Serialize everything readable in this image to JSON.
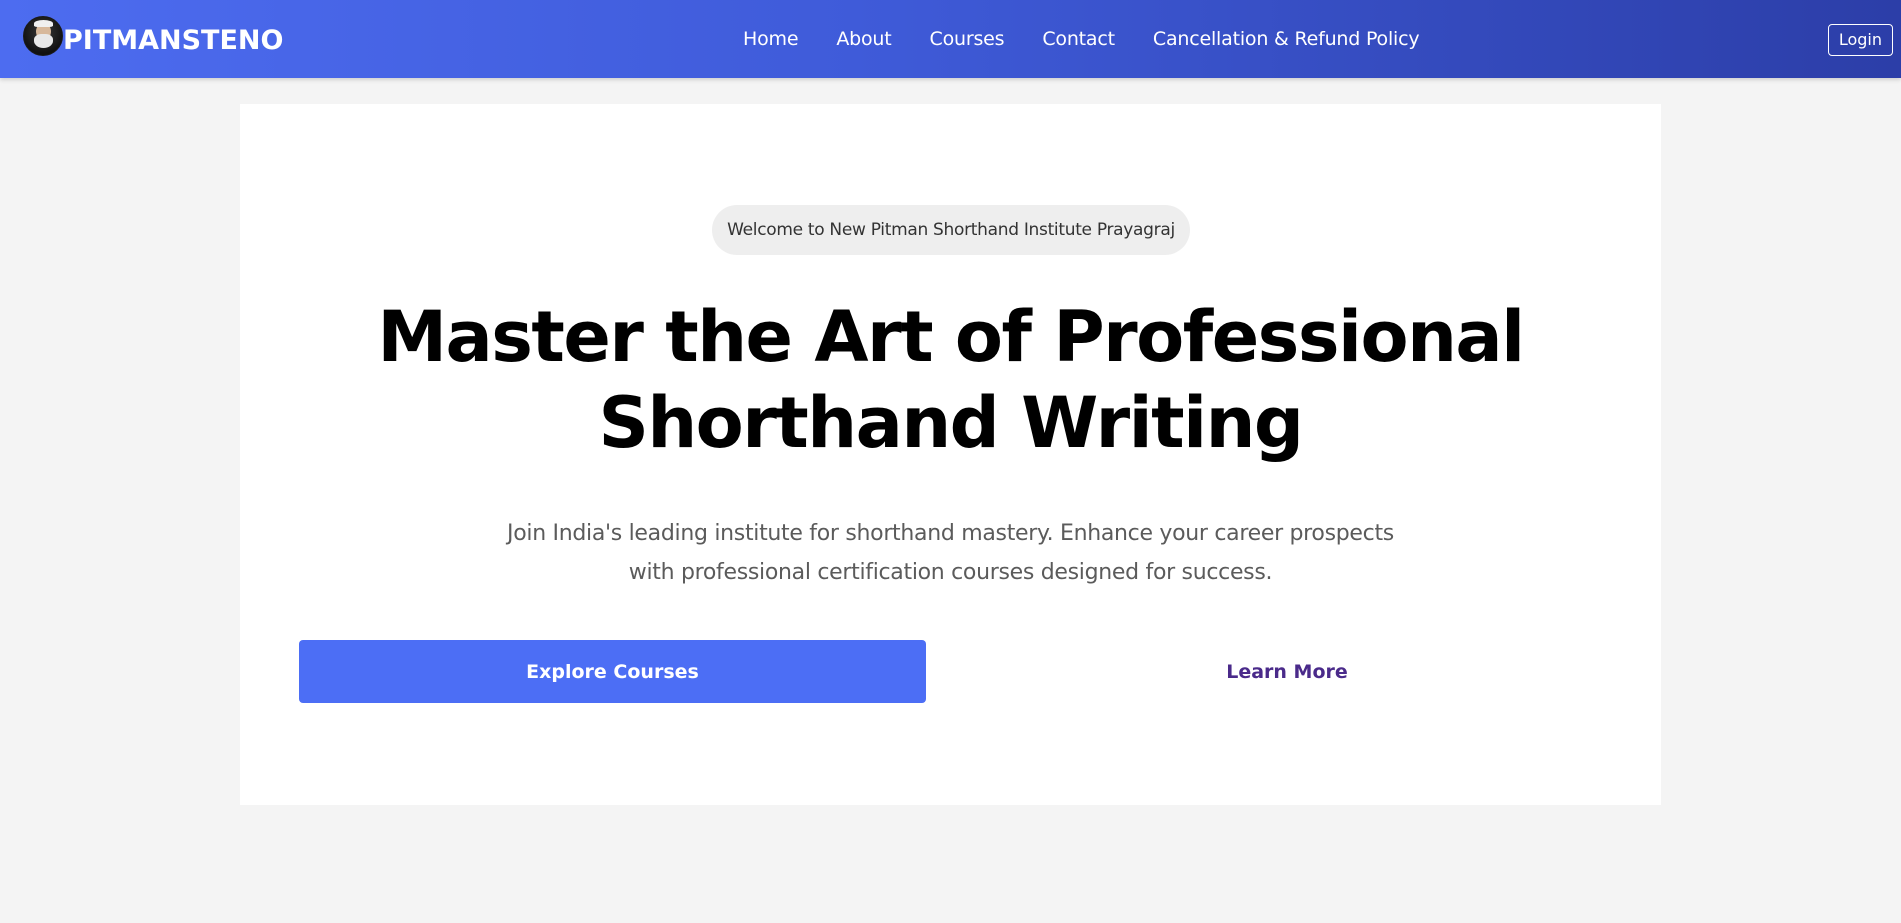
{
  "brand": {
    "name": "PITMANSTENO",
    "logo_icon": "avatar-logo-icon"
  },
  "nav": {
    "items": [
      {
        "label": "Home"
      },
      {
        "label": "About"
      },
      {
        "label": "Courses"
      },
      {
        "label": "Contact"
      },
      {
        "label": "Cancellation & Refund Policy"
      }
    ],
    "login_label": "Login"
  },
  "hero": {
    "welcome": "Welcome to New Pitman Shorthand Institute Prayagraj",
    "headline_line1": "Master the Art of Professional",
    "headline_line2": "Shorthand Writing",
    "subtitle_line1": "Join India's leading institute for shorthand mastery. Enhance your career prospects",
    "subtitle_line2": "with professional certification courses designed for success.",
    "primary_cta": "Explore Courses",
    "secondary_cta": "Learn More"
  },
  "colors": {
    "nav_gradient_start": "#4d6cf0",
    "nav_gradient_end": "#2c3ea8",
    "primary_button": "#4c6ef5",
    "secondary_link": "#4a2a8a",
    "page_background": "#f4f4f4"
  }
}
